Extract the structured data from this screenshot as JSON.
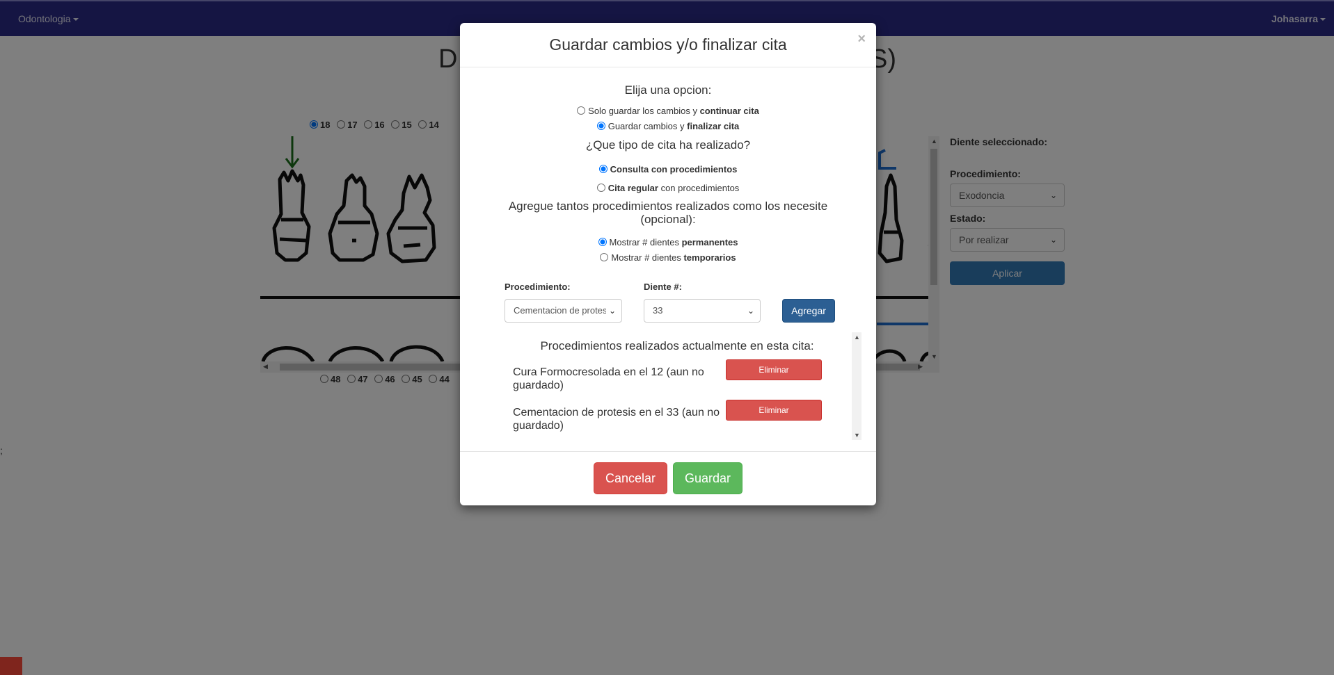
{
  "navbar": {
    "brand": "Odontologia",
    "user": "Johasarra"
  },
  "background": {
    "title_start": "D",
    "title_end": "S)",
    "upper_teeth": [
      "18",
      "17",
      "16",
      "15",
      "14"
    ],
    "upper_selected": "18",
    "lower_teeth": [
      "48",
      "47",
      "46",
      "45",
      "44"
    ],
    "side_panel": {
      "heading": "Diente seleccionado:",
      "procedure_label": "Procedimiento:",
      "procedure_value": "Exodoncia",
      "state_label": "Estado:",
      "state_value": "Por realizar",
      "apply_button": "Aplicar"
    },
    "stray_mark": ";"
  },
  "modal": {
    "title": "Guardar cambios y/o finalizar cita",
    "close_glyph": "×",
    "choose_prompt": "Elija una opcion:",
    "option_continue": {
      "pre": "Solo guardar los cambios y ",
      "bold": "continuar cita",
      "checked": false
    },
    "option_finish": {
      "pre": "Guardar cambios y ",
      "bold": "finalizar cita",
      "checked": true
    },
    "type_question": "¿Que tipo de cita ha realizado?",
    "type_consulta": {
      "bold": "Consulta con procedimientos",
      "checked": true
    },
    "type_regular": {
      "bold": "Cita regular",
      "post": " con procedimientos",
      "checked": false
    },
    "add_prompt_line1": "Agregue tantos procedimientos realizados como los necesite",
    "add_prompt_line2": "(opcional):",
    "show_permanent": {
      "pre": "Mostrar # dientes ",
      "bold": "permanentes",
      "checked": true
    },
    "show_temporary": {
      "pre": "Mostrar # dientes ",
      "bold": "temporarios",
      "checked": false
    },
    "procedure_label": "Procedimiento:",
    "procedure_value": "Cementacion de protesis",
    "tooth_label": "Diente #:",
    "tooth_value": "33",
    "add_button": "Agregar",
    "list_heading": "Procedimientos realizados actualmente en esta cita:",
    "procedures": [
      {
        "text": "Cura Formocresolada en el 12 (aun no guardado)",
        "button": "Eliminar"
      },
      {
        "text": "Cementacion de protesis en el 33 (aun no guardado)",
        "button": "Eliminar"
      }
    ],
    "cancel_button": "Cancelar",
    "save_button": "Guardar"
  },
  "colors": {
    "navbar": "#2b2b86",
    "primary": "#337ab7",
    "danger": "#d9534f",
    "success": "#5cb85c",
    "arrow": "#1a6e1a"
  }
}
